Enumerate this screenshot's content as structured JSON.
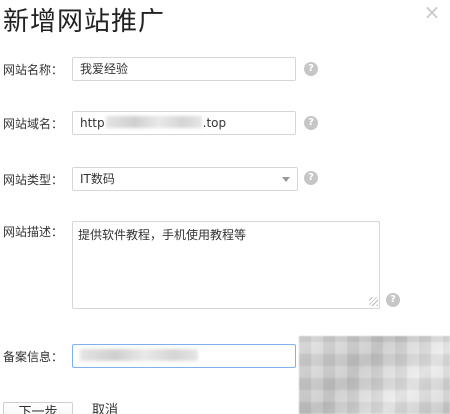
{
  "dialog": {
    "title": "新增网站推广",
    "close_glyph": "×"
  },
  "form": {
    "site_name": {
      "label": "网站名称：",
      "value": "我爱经验",
      "help_glyph": "?"
    },
    "site_domain": {
      "label": "网站域名：",
      "value_prefix": "http",
      "value_suffix": ".top",
      "help_glyph": "?"
    },
    "site_type": {
      "label": "网站类型：",
      "selected": "IT数码",
      "help_glyph": "?"
    },
    "site_description": {
      "label": "网站描述：",
      "value": "提供软件教程，手机使用教程等",
      "help_glyph": "?"
    },
    "filing_info": {
      "label": "备案信息："
    }
  },
  "buttons": {
    "next_label": "下一步",
    "cancel_label": "取消"
  },
  "icons": {
    "close": "close-icon",
    "help": "question-icon",
    "dropdown": "chevron-down-icon"
  },
  "colors": {
    "focus_border": "#7fb2e8",
    "help_icon_bg": "#c6c6c6"
  }
}
